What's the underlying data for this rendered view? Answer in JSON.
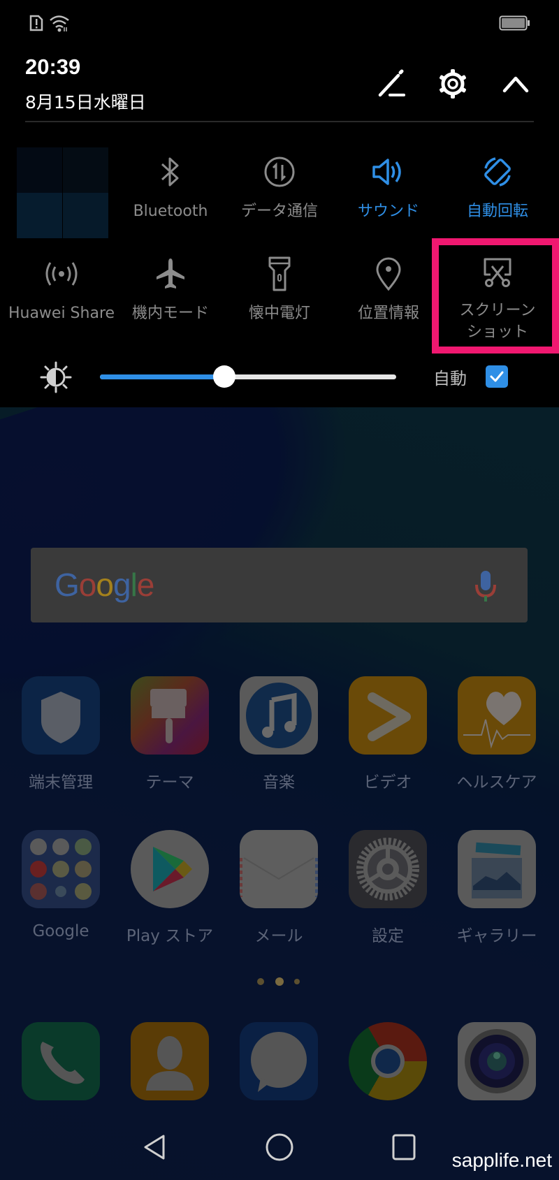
{
  "status_bar": {
    "sim_icon": "sim-alert-icon",
    "wifi_icon": "wifi-icon",
    "battery_icon": "battery-icon"
  },
  "header": {
    "time": "20:39",
    "date": "8月15日水曜日",
    "edit_icon": "pencil-icon",
    "settings_icon": "gear-icon",
    "collapse_icon": "chevron-up-icon"
  },
  "quick_tiles": [
    {
      "label": "Bluetooth",
      "icon": "bluetooth-icon",
      "active": false
    },
    {
      "label": "データ通信",
      "icon": "mobile-data-icon",
      "active": false
    },
    {
      "label": "サウンド",
      "icon": "speaker-icon",
      "active": true
    },
    {
      "label": "自動回転",
      "icon": "auto-rotate-icon",
      "active": true
    },
    {
      "label": "Huawei Share",
      "icon": "huawei-share-icon",
      "active": false
    },
    {
      "label": "機内モード",
      "icon": "airplane-icon",
      "active": false
    },
    {
      "label": "懐中電灯",
      "icon": "flashlight-icon",
      "active": false
    },
    {
      "label": "位置情報",
      "icon": "location-icon",
      "active": false
    },
    {
      "label": "スクリーン",
      "label2": "ショット",
      "icon": "screenshot-scissors-icon",
      "active": false,
      "highlighted": true
    }
  ],
  "brightness": {
    "icon": "brightness-icon",
    "level_percent": 42,
    "auto_label": "自動",
    "auto_checked": true
  },
  "colors": {
    "accent": "#2f8fe6",
    "highlight_box": "#f01870",
    "inactive_label": "#8c8c8c"
  },
  "home": {
    "search": {
      "logo": [
        "G",
        "o",
        "o",
        "g",
        "l",
        "e"
      ],
      "mic_icon": "mic-icon"
    },
    "apps_row1": [
      {
        "name": "端末管理",
        "icon": "shield-icon"
      },
      {
        "name": "テーマ",
        "icon": "paintbrush-icon"
      },
      {
        "name": "音楽",
        "icon": "music-note-icon"
      },
      {
        "name": "ビデオ",
        "icon": "play-icon"
      },
      {
        "name": "ヘルスケア",
        "icon": "heart-pulse-icon"
      }
    ],
    "apps_row2": [
      {
        "name": "Google",
        "icon": "google-folder-icon"
      },
      {
        "name": "Play ストア",
        "icon": "play-store-icon"
      },
      {
        "name": "メール",
        "icon": "envelope-icon"
      },
      {
        "name": "設定",
        "icon": "settings-gear-icon"
      },
      {
        "name": "ギャラリー",
        "icon": "gallery-icon"
      }
    ],
    "page_indicator": {
      "count": 3,
      "current": 2
    },
    "dock": [
      {
        "icon": "phone-icon",
        "name": "phone"
      },
      {
        "icon": "contacts-icon",
        "name": "contacts"
      },
      {
        "icon": "messages-icon",
        "name": "messages"
      },
      {
        "icon": "chrome-icon",
        "name": "chrome"
      },
      {
        "icon": "camera-icon",
        "name": "camera"
      }
    ]
  },
  "nav_bar": {
    "back_icon": "back-triangle-icon",
    "home_icon": "home-circle-icon",
    "recents_icon": "recents-square-icon"
  },
  "watermark": "sapplife.net"
}
